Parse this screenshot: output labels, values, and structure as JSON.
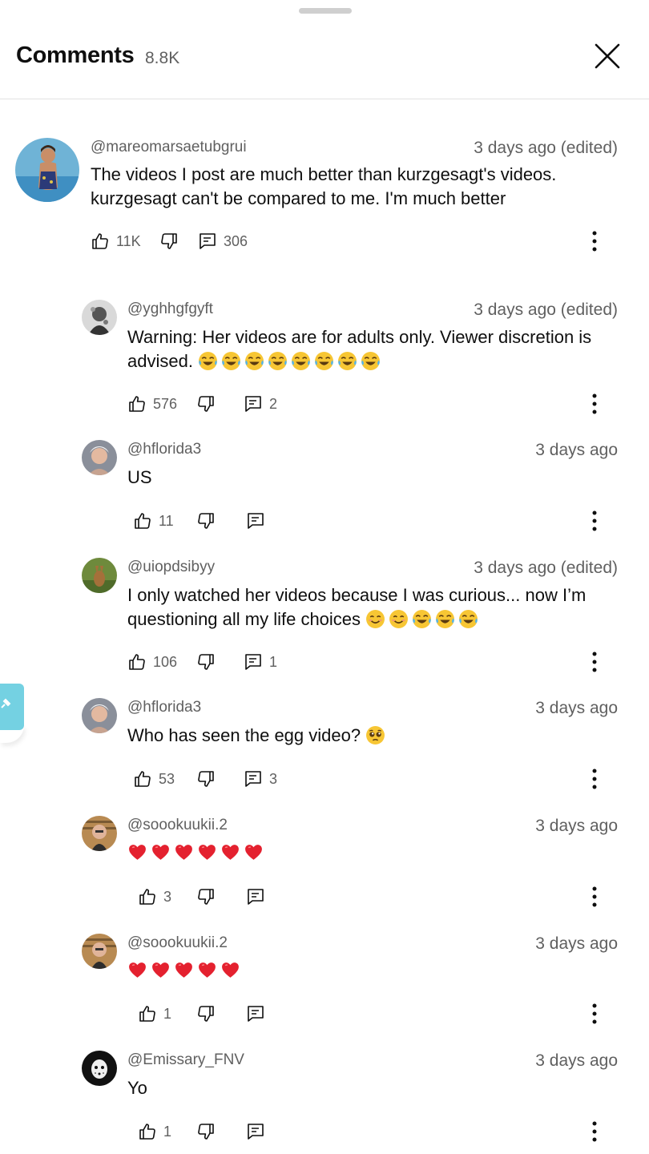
{
  "header": {
    "title": "Comments",
    "count": "8.8K"
  },
  "comments": [
    {
      "handle": "@mareomarsaetubgrui",
      "time": "3 days ago (edited)",
      "text": "The videos I post are much better than kurzgesagt's videos. kurzgesagt can't be compared to me. I'm much better",
      "likes": "11K",
      "replies": "306"
    },
    {
      "handle": "@yghhgfgyft",
      "time": "3 days ago (edited)",
      "text": "Warning: Her videos are for adults only. Viewer discretion is advised.",
      "emojis": [
        "joy",
        "joy",
        "joy",
        "joy",
        "joy",
        "joy",
        "joy",
        "joy"
      ],
      "likes": "576",
      "replies": "2"
    },
    {
      "handle": "@hflorida3",
      "time": "3 days ago",
      "text": "US",
      "likes": "11",
      "replies": ""
    },
    {
      "handle": "@uiopdsibyy",
      "time": "3 days ago (edited)",
      "text": "I only watched her videos because I was curious... now I’m questioning all my life choices",
      "emojis": [
        "smile",
        "smile",
        "joy",
        "joy",
        "joy"
      ],
      "likes": "106",
      "replies": "1"
    },
    {
      "handle": "@hflorida3",
      "time": "3 days ago",
      "text": "Who has seen the egg video?",
      "emojis": [
        "pleading"
      ],
      "likes": "53",
      "replies": "3"
    },
    {
      "handle": "@soookuukii.2",
      "time": "3 days ago",
      "text": "",
      "emojis": [
        "heart",
        "heart",
        "heart",
        "heart",
        "heart",
        "heart"
      ],
      "likes": "3",
      "replies": ""
    },
    {
      "handle": "@soookuukii.2",
      "time": "3 days ago",
      "text": "",
      "emojis": [
        "heart",
        "heart",
        "heart",
        "heart",
        "heart"
      ],
      "likes": "1",
      "replies": ""
    },
    {
      "handle": "@Emissary_FNV",
      "time": "3 days ago",
      "text": "Yo",
      "likes": "1",
      "replies": ""
    }
  ],
  "icons": {
    "close": "close-icon",
    "like": "thumbs-up-icon",
    "dislike": "thumbs-down-icon",
    "reply": "reply-icon",
    "more": "more-vertical-icon",
    "side_tab": "pin-icon"
  },
  "colors": {
    "accent_tab": "#74d1e2",
    "muted_text": "#606060",
    "text": "#0f0f0f"
  }
}
